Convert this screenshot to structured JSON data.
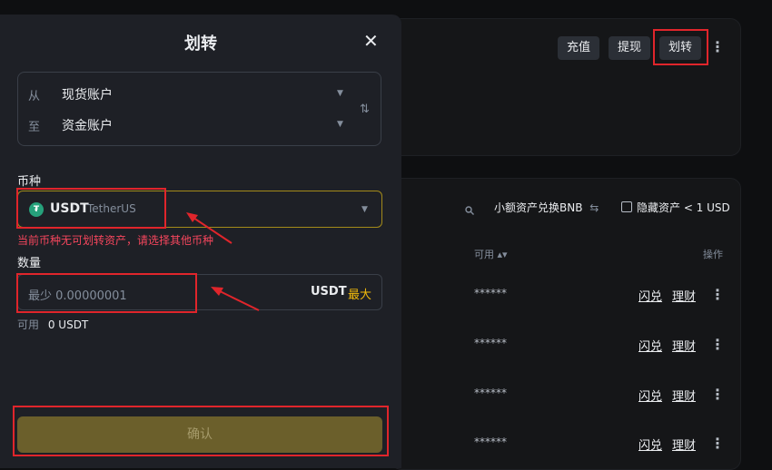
{
  "background": {
    "top_buttons": [
      "充值",
      "提现",
      "划转"
    ],
    "search_swap_label": "小额资产兑换BNB",
    "hide_assets_label": "隐藏资产 < 1 USD",
    "col_available": "可用",
    "col_actions": "操作",
    "masked_value": "******",
    "row_actions": [
      "闪兑",
      "理财"
    ]
  },
  "modal": {
    "title": "划转",
    "close_icon": "close-icon",
    "from_label": "从",
    "from_value": "现货账户",
    "to_label": "至",
    "to_value": "资金账户",
    "swap_icon": "swap-vertical-icon",
    "coin_label": "币种",
    "coin_symbol": "USDT",
    "coin_name": "TetherUS",
    "coin_icon": "tether-icon",
    "error_text": "当前币种无可划转资产，请选择其他币种",
    "amount_label": "数量",
    "amount_placeholder": "最少 0.00000001",
    "amount_unit": "USDT",
    "max_label": "最大",
    "available_label": "可用",
    "available_value": "0 USDT",
    "confirm_label": "确认"
  },
  "colors": {
    "accent": "#f0b90b",
    "error": "#f6465d",
    "highlight_box": "#e0252b",
    "confirm_bg": "#6b5f2b"
  }
}
